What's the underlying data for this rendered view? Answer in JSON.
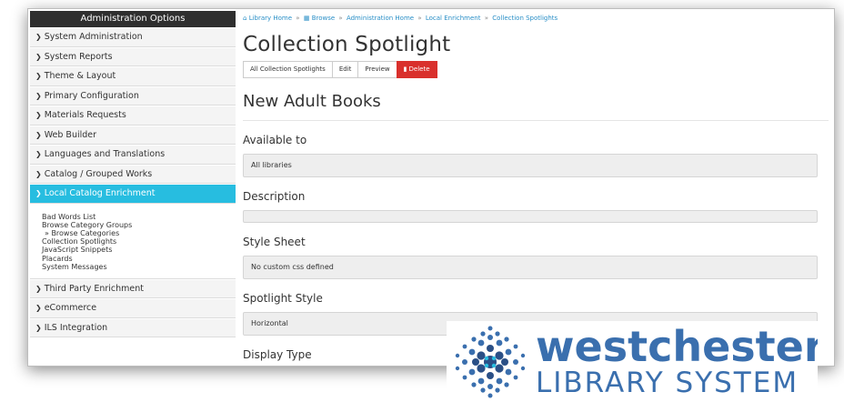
{
  "sidebar": {
    "header": "Administration Options",
    "items_top": [
      {
        "label": "System Administration"
      },
      {
        "label": "System Reports"
      },
      {
        "label": "Theme & Layout"
      },
      {
        "label": "Primary Configuration"
      },
      {
        "label": "Materials Requests"
      },
      {
        "label": "Web Builder"
      },
      {
        "label": "Languages and Translations"
      },
      {
        "label": "Catalog / Grouped Works"
      }
    ],
    "active_item": {
      "label": "Local Catalog Enrichment"
    },
    "sub_items": [
      "Bad Words List",
      "Browse Category Groups",
      "» Browse Categories",
      "Collection Spotlights",
      "JavaScript Snippets",
      "Placards",
      "System Messages"
    ],
    "items_bottom": [
      {
        "label": "Third Party Enrichment"
      },
      {
        "label": "eCommerce"
      },
      {
        "label": "ILS Integration"
      }
    ]
  },
  "breadcrumb": {
    "home": "Library Home",
    "browse": "Browse",
    "admin_home": "Administration Home",
    "local_enrichment": "Local Enrichment",
    "spotlights": "Collection Spotlights",
    "separator": "»"
  },
  "page": {
    "title": "Collection Spotlight",
    "buttons": {
      "all": "All Collection Spotlights",
      "edit": "Edit",
      "preview": "Preview",
      "delete": "Delete"
    },
    "subtitle": "New Adult Books",
    "fields": {
      "available_to": {
        "label": "Available to",
        "value": "All libraries"
      },
      "description": {
        "label": "Description",
        "value": ""
      },
      "style_sheet": {
        "label": "Style Sheet",
        "value": "No custom css defined"
      },
      "spotlight_style": {
        "label": "Spotlight Style",
        "value": "Horizontal"
      },
      "display_type": {
        "label": "Display Type"
      }
    }
  },
  "logo": {
    "line1": "westchester",
    "line2": "LIBRARY SYSTEM",
    "color": "#3a6fae",
    "accent": "#27bde0"
  },
  "colors": {
    "active_item": "#27bde0",
    "sidebar_header": "#2f2f2f",
    "delete_button": "#d9302c",
    "link": "#2a8fc7"
  }
}
